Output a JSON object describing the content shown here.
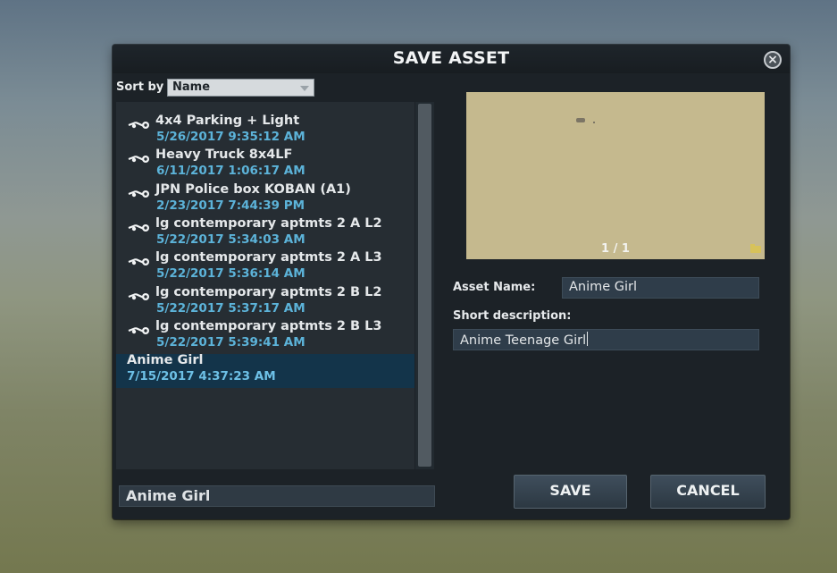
{
  "dialog": {
    "title": "SAVE ASSET",
    "close_icon": "close-circle-icon"
  },
  "sort": {
    "label": "Sort by",
    "selected": "Name"
  },
  "assets": [
    {
      "name": "4x4 Parking + Light",
      "date": "5/26/2017 9:35:12 AM",
      "icon": "steam-workshop-icon"
    },
    {
      "name": "Heavy Truck 8x4LF",
      "date": "6/11/2017 1:06:17 AM",
      "icon": "steam-workshop-icon"
    },
    {
      "name": "JPN Police box KOBAN  (A1)",
      "date": "2/23/2017 7:44:39 PM",
      "icon": "steam-workshop-icon"
    },
    {
      "name": "lg contemporary aptmts 2 A L2",
      "date": "5/22/2017 5:34:03 AM",
      "icon": "steam-workshop-icon"
    },
    {
      "name": "lg contemporary aptmts 2 A L3",
      "date": "5/22/2017 5:36:14 AM",
      "icon": "steam-workshop-icon"
    },
    {
      "name": "lg contemporary aptmts 2 B L2",
      "date": "5/22/2017 5:37:17 AM",
      "icon": "steam-workshop-icon"
    },
    {
      "name": "lg contemporary aptmts 2 B L3",
      "date": "5/22/2017 5:39:41 AM",
      "icon": "steam-workshop-icon"
    },
    {
      "name": "Anime Girl",
      "date": "7/15/2017 4:37:23 AM",
      "icon": "",
      "selected": true
    }
  ],
  "filename": "Anime Girl",
  "preview": {
    "counter": "1 / 1",
    "background_color": "#c5b98e"
  },
  "form": {
    "asset_name_label": "Asset Name:",
    "asset_name_value": "Anime Girl",
    "description_label": "Short description:",
    "description_value": "Anime Teenage Girl"
  },
  "buttons": {
    "save": "SAVE",
    "cancel": "CANCEL"
  },
  "colors": {
    "date_text": "#5cb3d9",
    "selected_row": "#13344a"
  }
}
